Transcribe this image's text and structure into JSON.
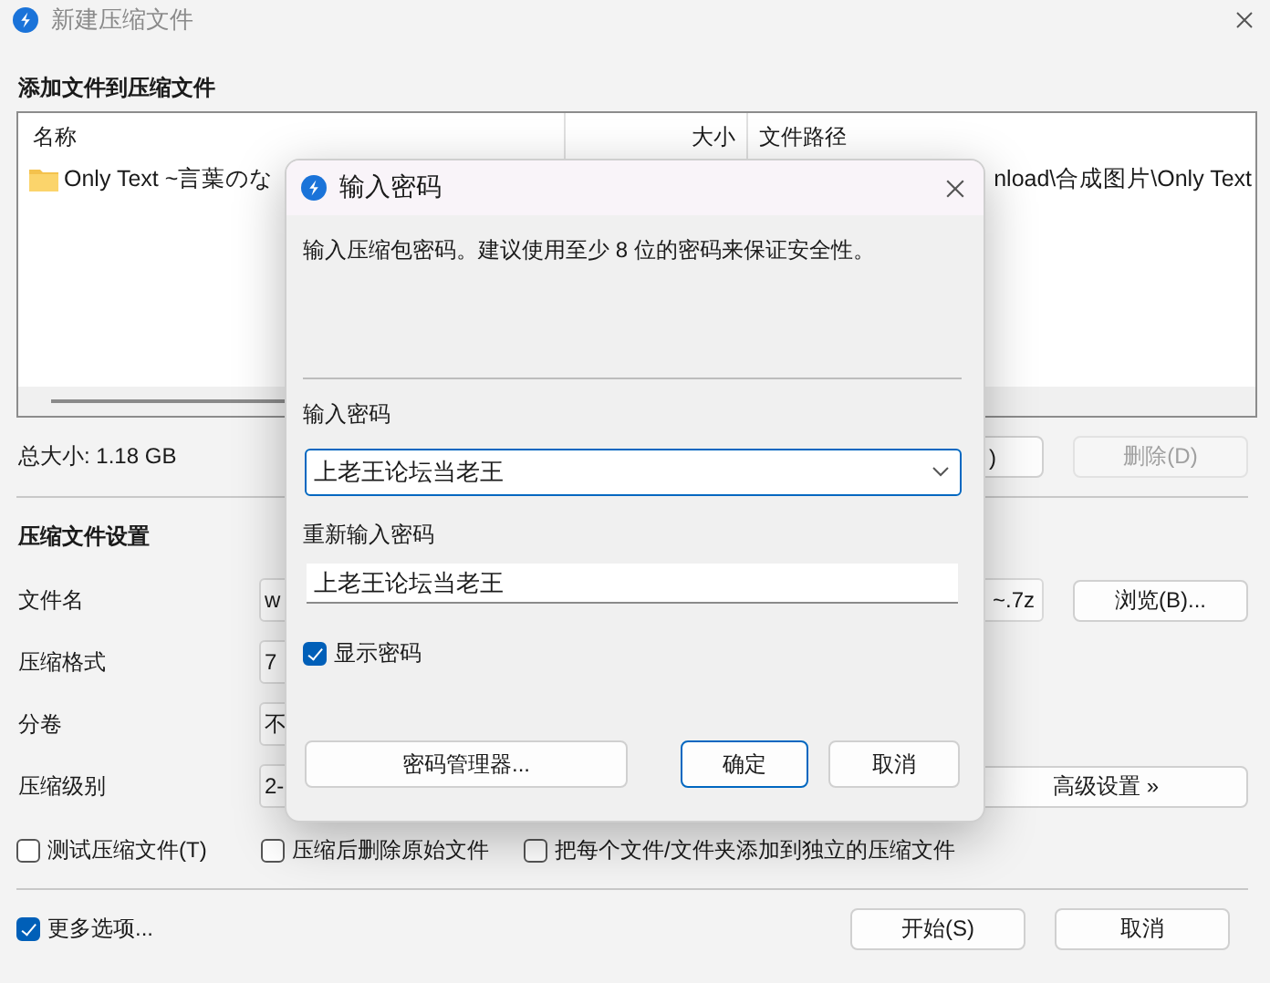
{
  "window": {
    "title": "新建压缩文件"
  },
  "files": {
    "heading": "添加文件到压缩文件",
    "columns": [
      "名称",
      "大小",
      "文件路径"
    ],
    "rows": [
      {
        "name": "Only Text ~言葉のな",
        "path": "nload\\合成图片\\Only Text"
      }
    ],
    "total_size": "总大小: 1.18 GB",
    "buttons": [
      {
        "label": ")",
        "disabled": false
      },
      {
        "label": "删除(D)",
        "disabled": true
      }
    ]
  },
  "settings": {
    "heading": "压缩文件设置",
    "rows": [
      {
        "kind": "text",
        "label": "文件名",
        "value": "w",
        "value_tail": "~.7z",
        "button": "浏览(B)..."
      },
      {
        "kind": "select",
        "label": "压缩格式",
        "value": "7"
      },
      {
        "kind": "select",
        "label": "分卷",
        "value": "不"
      },
      {
        "kind": "select",
        "label": "压缩级别",
        "value": "2-",
        "button": "高级设置 »"
      }
    ],
    "options": [
      {
        "label": "测试压缩文件(T)",
        "checked": false
      },
      {
        "label": "压缩后删除原始文件",
        "checked": false
      },
      {
        "label": "把每个文件/文件夹添加到独立的压缩文件",
        "checked": false
      }
    ]
  },
  "footer": {
    "more_options": {
      "label": "更多选项...",
      "checked": true
    },
    "buttons": [
      "开始(S)",
      "取消"
    ]
  },
  "dialog": {
    "title": "输入密码",
    "description": "输入压缩包密码。建议使用至少 8 位的密码来保证安全性。",
    "password_label": "输入密码",
    "password": "上老王论坛当老王",
    "confirm_label": "重新输入密码",
    "confirm": "上老王论坛当老王",
    "show_password": {
      "label": "显示密码",
      "checked": true
    },
    "buttons": [
      {
        "label": "密码管理器...",
        "default": false
      },
      {
        "label": "确定",
        "default": true
      },
      {
        "label": "取消",
        "default": false
      }
    ]
  }
}
